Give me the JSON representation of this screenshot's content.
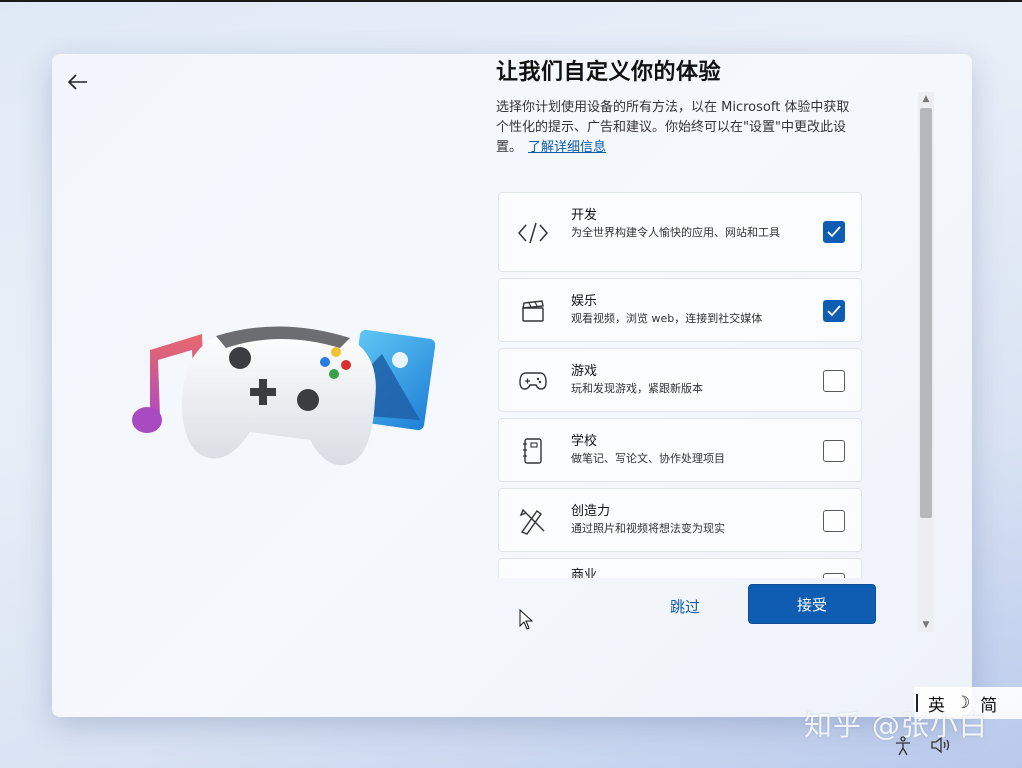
{
  "header": {
    "title": "让我们自定义你的体验",
    "description": "选择你计划使用设备的所有方法，以在 Microsoft 体验中获取个性化的提示、广告和建议。你始终可以在\"设置\"中更改此设置。",
    "learn_more": "了解详细信息"
  },
  "options": [
    {
      "name": "开发",
      "desc": "为全世界构建令人愉快的应用、网站和工具",
      "icon": "code-icon",
      "checked": true
    },
    {
      "name": "娱乐",
      "desc": "观看视频，浏览 web，连接到社交媒体",
      "icon": "clapperboard-icon",
      "checked": true
    },
    {
      "name": "游戏",
      "desc": "玩和发现游戏，紧跟新版本",
      "icon": "gamepad-icon",
      "checked": false
    },
    {
      "name": "学校",
      "desc": "做笔记、写论文、协作处理项目",
      "icon": "notebook-icon",
      "checked": false
    },
    {
      "name": "创造力",
      "desc": "通过照片和视频将想法变为现实",
      "icon": "pen-brush-icon",
      "checked": false
    },
    {
      "name": "商业",
      "desc": "",
      "icon": "briefcase-icon",
      "checked": false
    }
  ],
  "buttons": {
    "skip": "跳过",
    "accept": "接受"
  },
  "ime": {
    "mode": "英",
    "moon": "☽",
    "script": "简"
  },
  "watermark": "知乎 @张小白",
  "colors": {
    "accent": "#0f5cb3",
    "link": "#0f5ca8"
  }
}
